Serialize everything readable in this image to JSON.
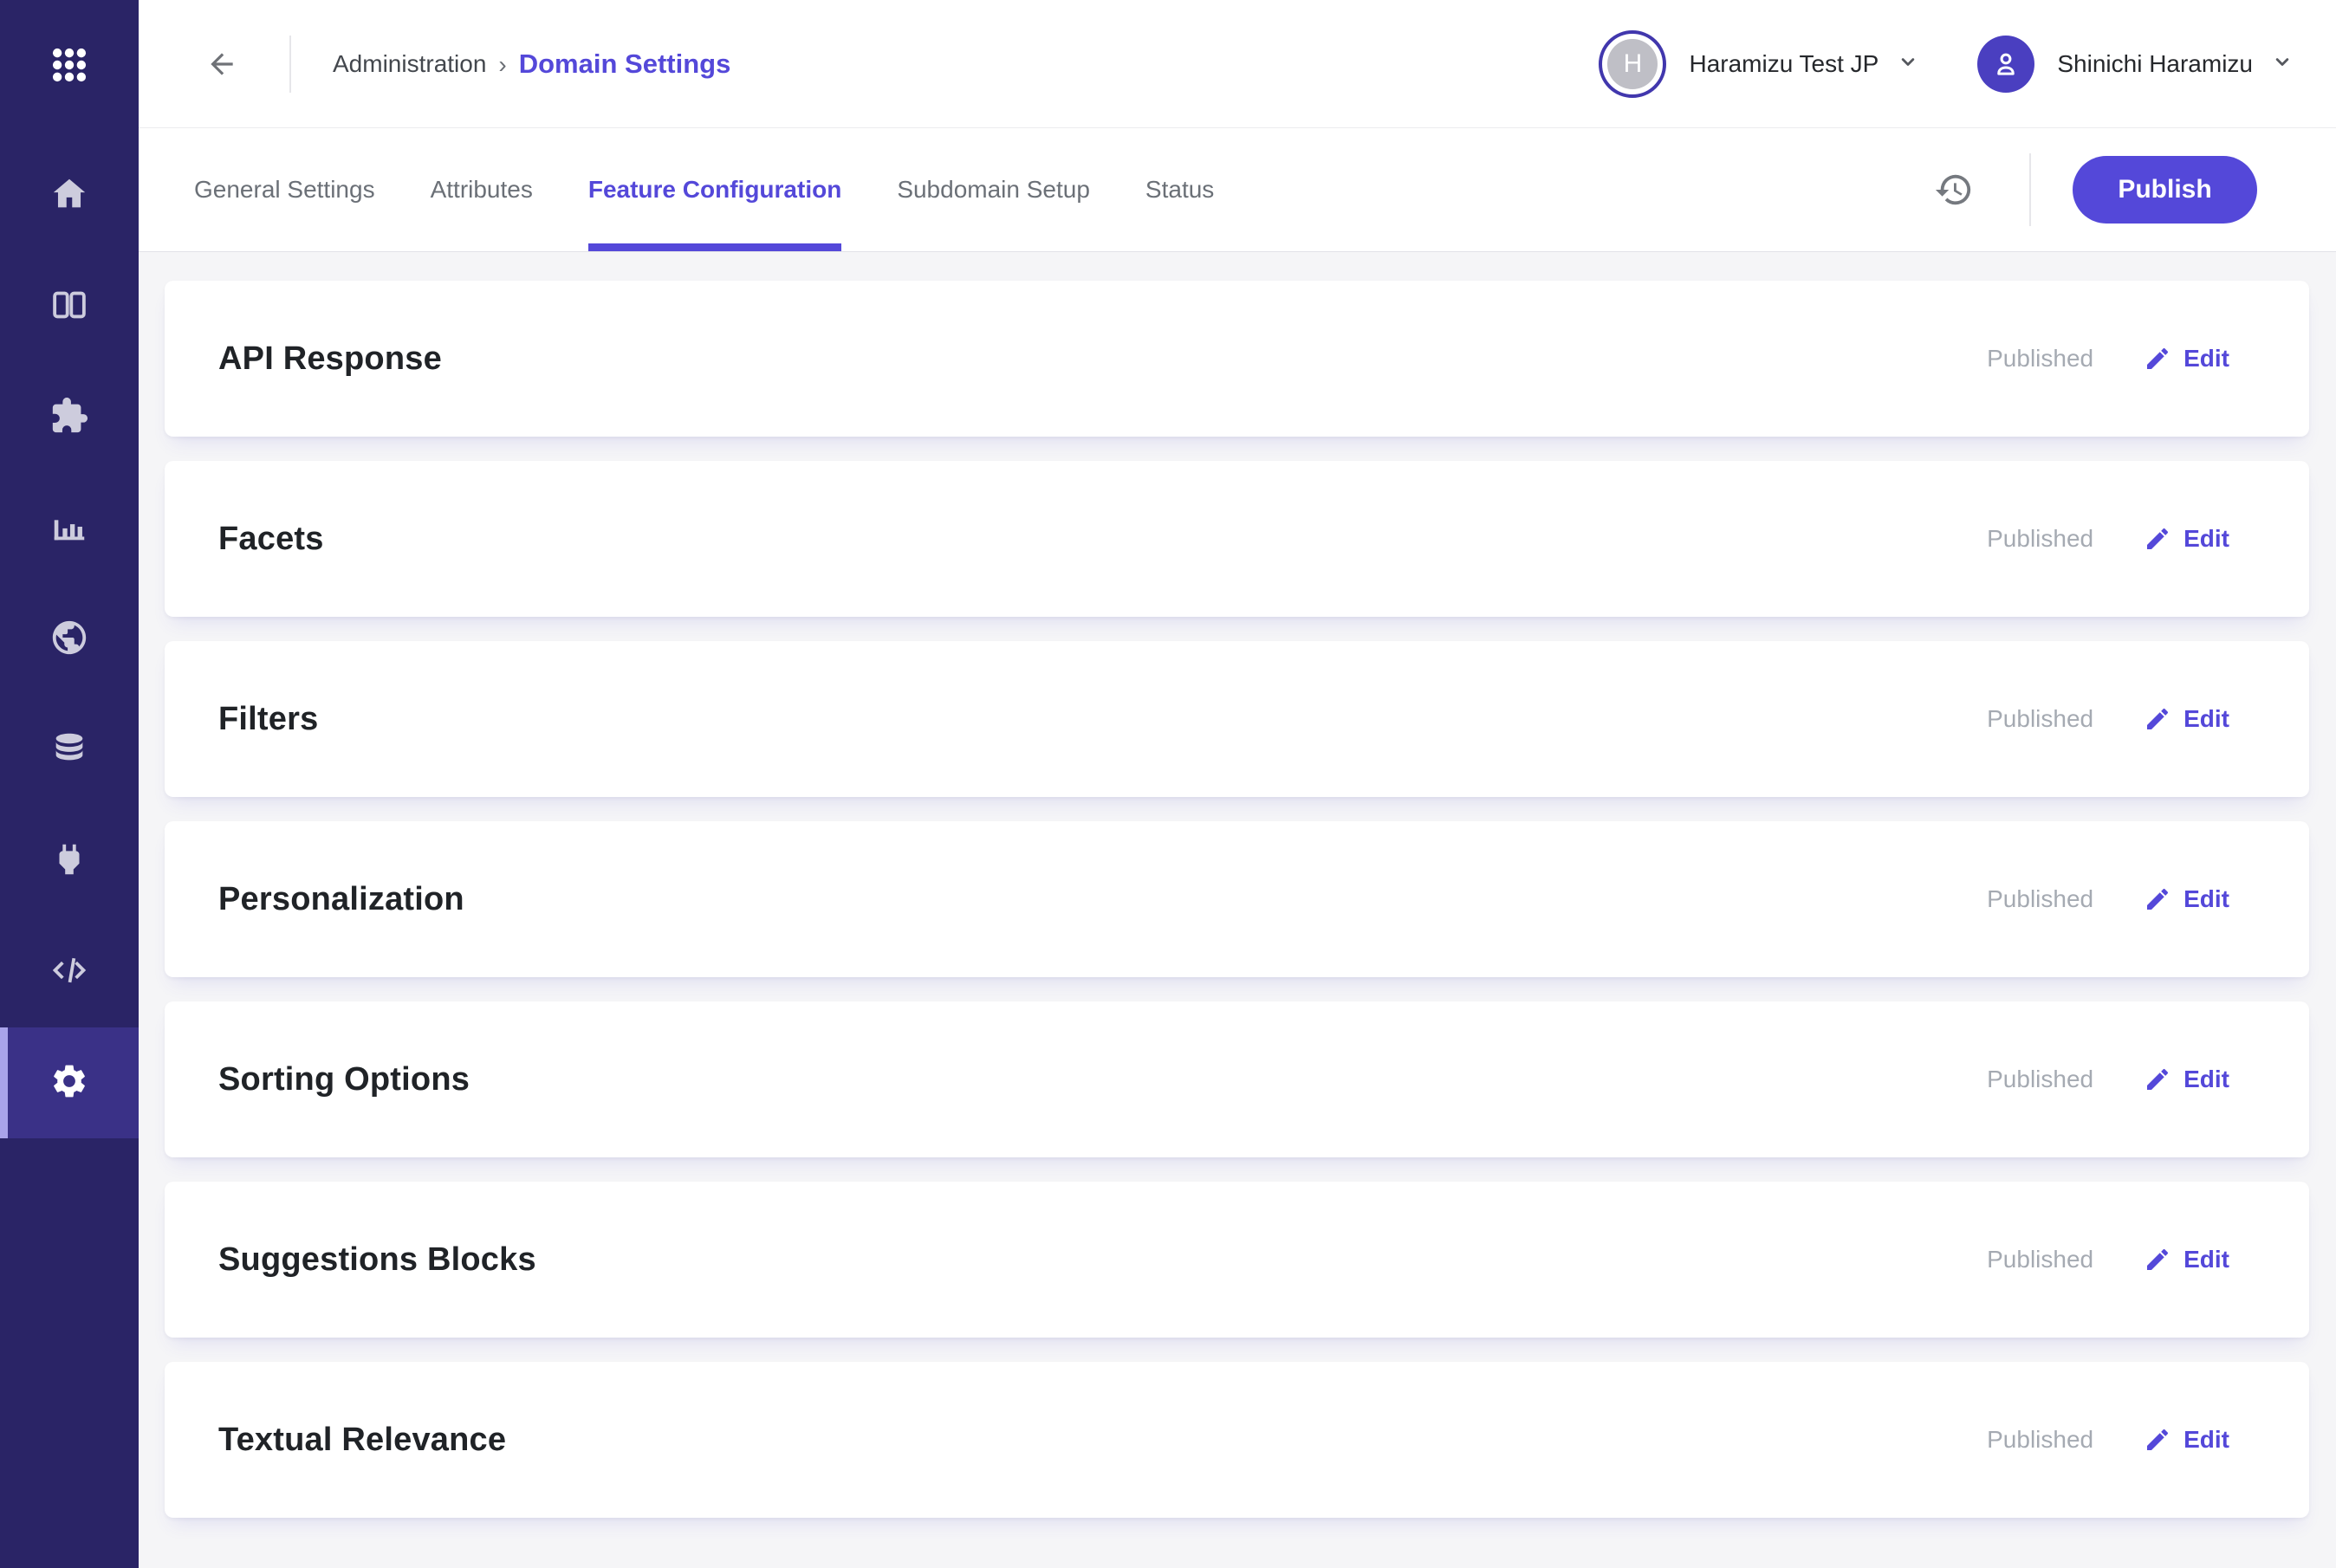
{
  "colors": {
    "accent": "#5448d9",
    "sidebar_bg": "#2a2466",
    "sidebar_active_bg": "#3a3187",
    "sidebar_active_accent": "#a9a3ea",
    "status_text": "#a5aab2",
    "page_bg": "#f5f5f7"
  },
  "sidebar": {
    "apps_icon": "apps-grid",
    "items": [
      {
        "name": "home",
        "icon": "home"
      },
      {
        "name": "collections",
        "icon": "columns"
      },
      {
        "name": "extensions",
        "icon": "puzzle"
      },
      {
        "name": "analytics",
        "icon": "bar-chart"
      },
      {
        "name": "domains",
        "icon": "globe"
      },
      {
        "name": "data",
        "icon": "database"
      },
      {
        "name": "integrations",
        "icon": "plug"
      },
      {
        "name": "developer",
        "icon": "code"
      },
      {
        "name": "settings",
        "icon": "gear",
        "active": true
      }
    ]
  },
  "header": {
    "breadcrumb": {
      "section": "Administration",
      "separator": "›",
      "page": "Domain Settings"
    },
    "org": {
      "initial": "H",
      "name": "Haramizu Test JP"
    },
    "user": {
      "name": "Shinichi Haramizu"
    }
  },
  "tabs": [
    {
      "label": "General Settings"
    },
    {
      "label": "Attributes"
    },
    {
      "label": "Feature Configuration",
      "active": true
    },
    {
      "label": "Subdomain Setup"
    },
    {
      "label": "Status"
    }
  ],
  "toolbar": {
    "publish_label": "Publish"
  },
  "cards": [
    {
      "title": "API Response",
      "status": "Published",
      "action": "Edit"
    },
    {
      "title": "Facets",
      "status": "Published",
      "action": "Edit"
    },
    {
      "title": "Filters",
      "status": "Published",
      "action": "Edit"
    },
    {
      "title": "Personalization",
      "status": "Published",
      "action": "Edit"
    },
    {
      "title": "Sorting Options",
      "status": "Published",
      "action": "Edit"
    },
    {
      "title": "Suggestions Blocks",
      "status": "Published",
      "action": "Edit"
    },
    {
      "title": "Textual Relevance",
      "status": "Published",
      "action": "Edit"
    }
  ]
}
